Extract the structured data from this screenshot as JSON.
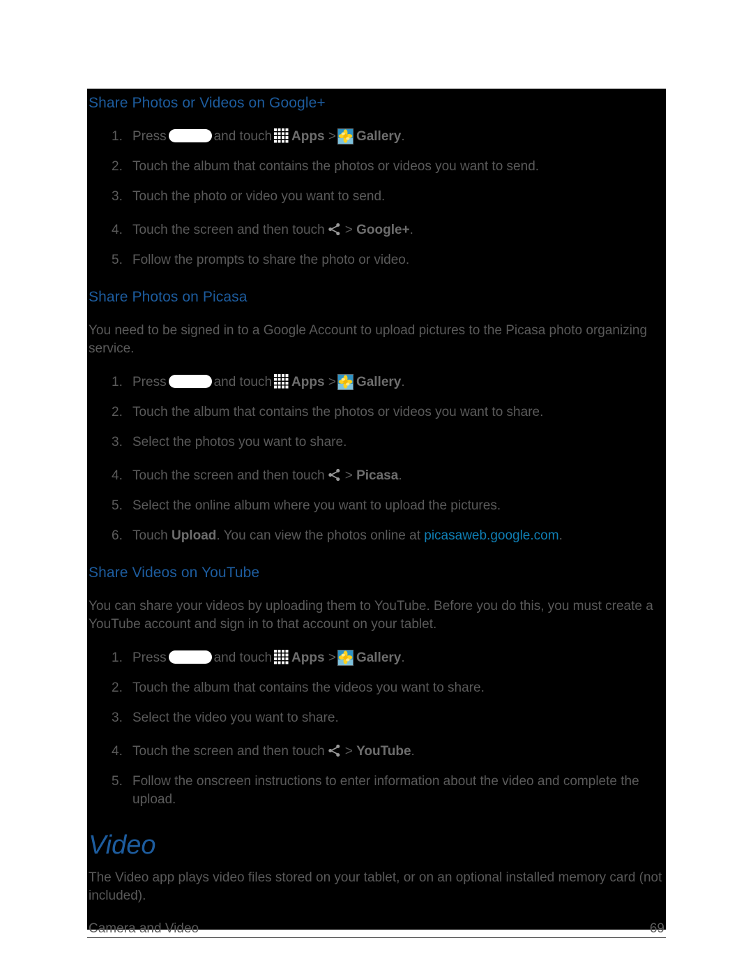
{
  "page": {
    "background_color": "#ffffff",
    "plate_color": "#000000",
    "heading_color": "#1d5c9e",
    "body_color": "#5a5a5a",
    "bold_color": "#6d6d6d",
    "link_color": "#0f7fb5"
  },
  "sections": [
    {
      "id": "share-google-plus",
      "heading": "Share Photos or Videos on Google+",
      "steps": [
        {
          "pre": "Press",
          "home_key": true,
          "mid": "and touch",
          "apps_icon": true,
          "apps_label": "Apps",
          "sep": ">",
          "gallery_icon": true,
          "gallery_label": "Gallery",
          "post": "."
        },
        {
          "text": "Touch the album that contains the photos or videos you want to send."
        },
        {
          "text": "Touch the photo or video you want to send."
        },
        {
          "pre": "Touch the screen and then touch",
          "share_icon": true,
          "sep": ">",
          "bold": "Google+",
          "post": "."
        },
        {
          "text": "Follow the prompts to share the photo or video."
        }
      ]
    },
    {
      "id": "share-picasa",
      "heading": "Share Photos on Picasa",
      "intro": "You need to be signed in to a Google Account to upload pictures to the Picasa photo organizing service.",
      "steps": [
        {
          "pre": "Press",
          "home_key": true,
          "mid": "and touch",
          "apps_icon": true,
          "apps_label": "Apps",
          "sep": ">",
          "gallery_icon": true,
          "gallery_label": "Gallery",
          "post": "."
        },
        {
          "text": "Touch the album that contains the photos or videos you want to share."
        },
        {
          "text": "Select the photos you want to share."
        },
        {
          "pre": "Touch the screen and then touch",
          "share_icon": true,
          "sep": ">",
          "bold": "Picasa",
          "post": "."
        },
        {
          "text": "Select the online album where you want to upload the pictures."
        },
        {
          "pre": "Touch",
          "bold": "Upload",
          "mid2": ". You can view the photos online at",
          "link": "picasaweb.google.com",
          "post": "."
        }
      ]
    },
    {
      "id": "share-youtube",
      "heading": "Share Videos on YouTube",
      "intro": "You can share your videos by uploading them to YouTube. Before you do this, you must create a YouTube account and sign in to that account on your tablet.",
      "steps": [
        {
          "pre": "Press",
          "home_key": true,
          "mid": "and touch",
          "apps_icon": true,
          "apps_label": "Apps",
          "sep": ">",
          "gallery_icon": true,
          "gallery_label": "Gallery",
          "post": "."
        },
        {
          "text": "Touch the album that contains the videos you want to share."
        },
        {
          "text": "Select the video you want to share."
        },
        {
          "pre": "Touch the screen and then touch",
          "share_icon": true,
          "sep": ">",
          "bold": "YouTube",
          "post": "."
        },
        {
          "text": "Follow the onscreen instructions to enter information about the video and complete the upload."
        }
      ]
    }
  ],
  "video_section": {
    "title": "Video",
    "body": "The Video app plays video files stored on your tablet, or on an optional installed memory card (not included)."
  },
  "footer": {
    "left": "Camera and Video",
    "page_number": "69"
  },
  "icons": {
    "home_key": "home-key-icon",
    "apps": "apps-grid-icon",
    "gallery": "gallery-flower-icon",
    "share": "share-icon"
  }
}
